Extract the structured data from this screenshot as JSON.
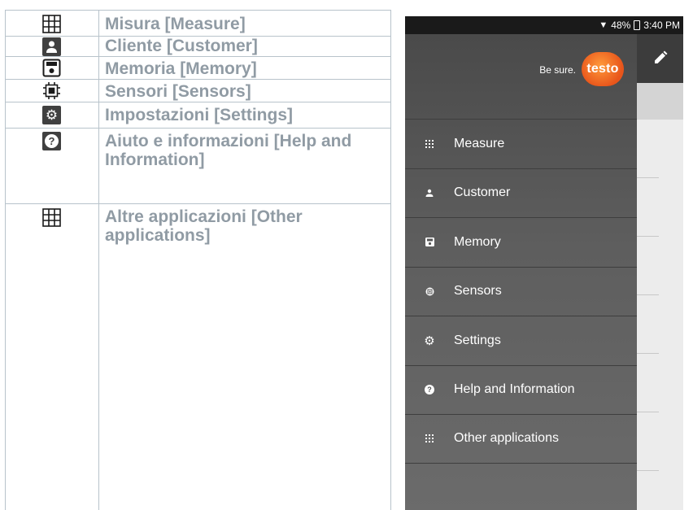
{
  "legend": {
    "rows": [
      {
        "icon": "grid-icon",
        "label": "Misura [Measure]"
      },
      {
        "icon": "person-icon",
        "label": "Cliente [Customer]"
      },
      {
        "icon": "save-icon",
        "label": "Memoria [Memory]"
      },
      {
        "icon": "sensor-chip-icon",
        "label": "Sensori [Sensors]"
      },
      {
        "icon": "gear-icon",
        "label": "Impostazioni [Settings]"
      },
      {
        "icon": "help-icon",
        "label": "Aiuto e informazioni [Help and Information]"
      },
      {
        "icon": "grid-icon",
        "label": "Altre applicazioni [Other applications]"
      }
    ]
  },
  "phone": {
    "status": {
      "battery": "48%",
      "time": "3:40 PM"
    },
    "brand": {
      "tagline": "Be sure.",
      "logo": "testo"
    },
    "menu": [
      {
        "icon": "grid-icon",
        "label": "Measure"
      },
      {
        "icon": "person-icon",
        "label": "Customer"
      },
      {
        "icon": "save-icon",
        "label": "Memory"
      },
      {
        "icon": "sensor-icon",
        "label": "Sensors"
      },
      {
        "icon": "gear-icon",
        "label": "Settings"
      },
      {
        "icon": "help-icon",
        "label": "Help and Information"
      },
      {
        "icon": "grid-icon",
        "label": "Other applications"
      }
    ],
    "colors": {
      "accent": "#e8551b",
      "drawer": "#555555",
      "legend_text": "#909ba4"
    }
  }
}
